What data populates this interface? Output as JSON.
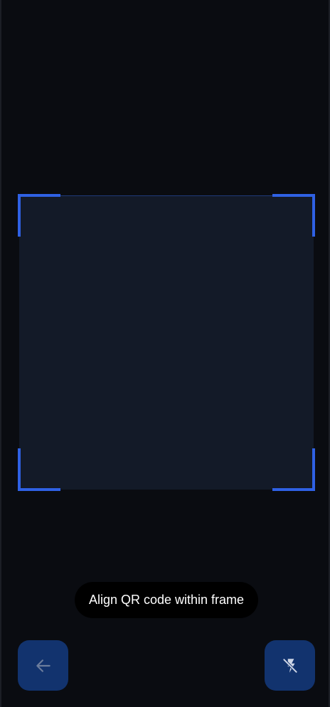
{
  "scanner": {
    "hint_text": "Align QR code within frame"
  },
  "controls": {
    "back_icon": "arrow-left-icon",
    "flash_icon": "flash-off-icon"
  },
  "colors": {
    "background": "#0a0c11",
    "frame_fill": "#131a28",
    "frame_corner": "#2f61e4",
    "button_bg": "#12336e",
    "back_icon": "#6c7d9c",
    "flash_icon": "#cfd6e6"
  }
}
